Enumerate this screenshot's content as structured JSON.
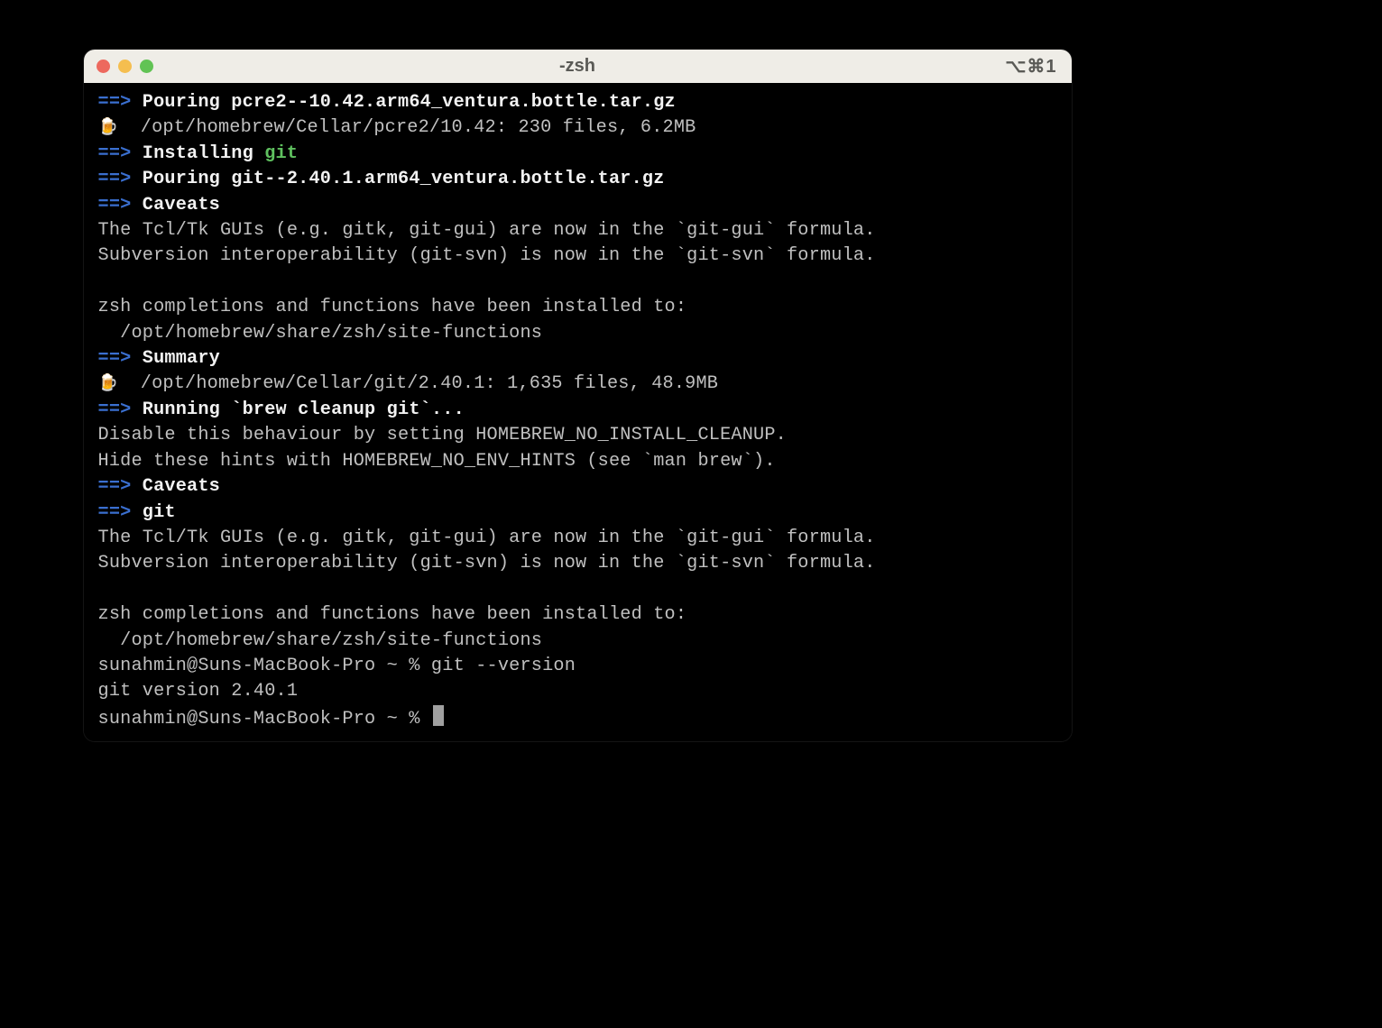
{
  "window": {
    "title": "-zsh",
    "shortcut": "⌥⌘1"
  },
  "lines": {
    "l1": {
      "arrow": "==>",
      "text": " Pouring pcre2--10.42.arm64_ventura.bottle.tar.gz"
    },
    "l2": {
      "icon": "🍺",
      "text": "  /opt/homebrew/Cellar/pcre2/10.42: 230 files, 6.2MB"
    },
    "l3": {
      "arrow": "==>",
      "text": " Installing ",
      "green": "git"
    },
    "l4": {
      "arrow": "==>",
      "text": " Pouring git--2.40.1.arm64_ventura.bottle.tar.gz"
    },
    "l5": {
      "arrow": "==>",
      "text": " Caveats"
    },
    "l6": "The Tcl/Tk GUIs (e.g. gitk, git-gui) are now in the `git-gui` formula.",
    "l7": "Subversion interoperability (git-svn) is now in the `git-svn` formula.",
    "l8": " ",
    "l9": "zsh completions and functions have been installed to:",
    "l10": "  /opt/homebrew/share/zsh/site-functions",
    "l11": {
      "arrow": "==>",
      "text": " Summary"
    },
    "l12": {
      "icon": "🍺",
      "text": "  /opt/homebrew/Cellar/git/2.40.1: 1,635 files, 48.9MB"
    },
    "l13": {
      "arrow": "==>",
      "text": " Running `brew cleanup git`..."
    },
    "l14": "Disable this behaviour by setting HOMEBREW_NO_INSTALL_CLEANUP.",
    "l15": "Hide these hints with HOMEBREW_NO_ENV_HINTS (see `man brew`).",
    "l16": {
      "arrow": "==>",
      "text": " Caveats"
    },
    "l17": {
      "arrow": "==>",
      "text": " git"
    },
    "l18": "The Tcl/Tk GUIs (e.g. gitk, git-gui) are now in the `git-gui` formula.",
    "l19": "Subversion interoperability (git-svn) is now in the `git-svn` formula.",
    "l20": " ",
    "l21": "zsh completions and functions have been installed to:",
    "l22": "  /opt/homebrew/share/zsh/site-functions",
    "l23": "sunahmin@Suns-MacBook-Pro ~ % git --version",
    "l24": "git version 2.40.1",
    "l25": "sunahmin@Suns-MacBook-Pro ~ % "
  }
}
